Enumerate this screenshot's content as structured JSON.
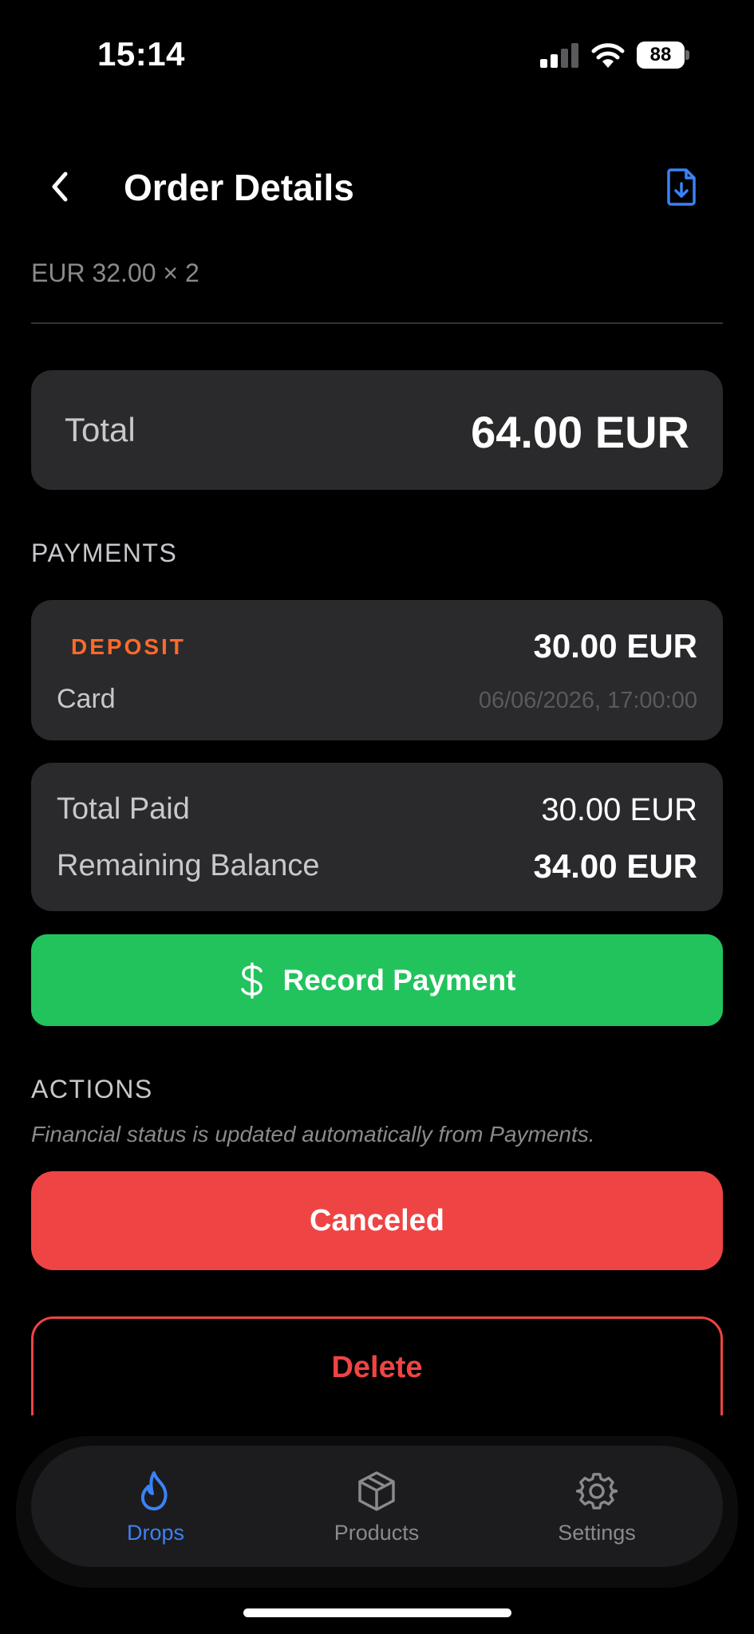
{
  "status_bar": {
    "time": "15:14",
    "battery_percent": "88",
    "signal_bars_active": 2
  },
  "nav": {
    "title": "Order Details",
    "back_icon": "chevron-left-icon",
    "action_icon": "document-download-icon"
  },
  "line_item": {
    "price_text": "EUR 32.00 × 2"
  },
  "total": {
    "label": "Total",
    "value": "64.00 EUR"
  },
  "payments": {
    "section_label": "PAYMENTS",
    "items": [
      {
        "type": "DEPOSIT",
        "amount": "30.00 EUR",
        "method": "Card",
        "date": "06/06/2026, 17:00:00"
      }
    ]
  },
  "summary": {
    "total_paid_label": "Total Paid",
    "total_paid_value": "30.00 EUR",
    "remaining_label": "Remaining Balance",
    "remaining_value": "34.00 EUR"
  },
  "record_payment": {
    "label": "Record Payment",
    "icon": "dollar-icon"
  },
  "actions": {
    "section_label": "ACTIONS",
    "note": "Financial status is updated automatically from Payments.",
    "status_button_label": "Canceled",
    "delete_button_label": "Delete"
  },
  "tab_bar": {
    "tabs": [
      {
        "label": "Drops",
        "icon": "flame-icon",
        "active": true
      },
      {
        "label": "Products",
        "icon": "box-icon",
        "active": false
      },
      {
        "label": "Settings",
        "icon": "gear-icon",
        "active": false
      }
    ]
  },
  "colors": {
    "background": "#000000",
    "card": "#2a2a2c",
    "accent_blue": "#3b82f6",
    "deposit_orange": "#ff6a2b",
    "success_green": "#22c35d",
    "danger_red": "#ef4444",
    "muted_text": "#8a8a8e"
  }
}
